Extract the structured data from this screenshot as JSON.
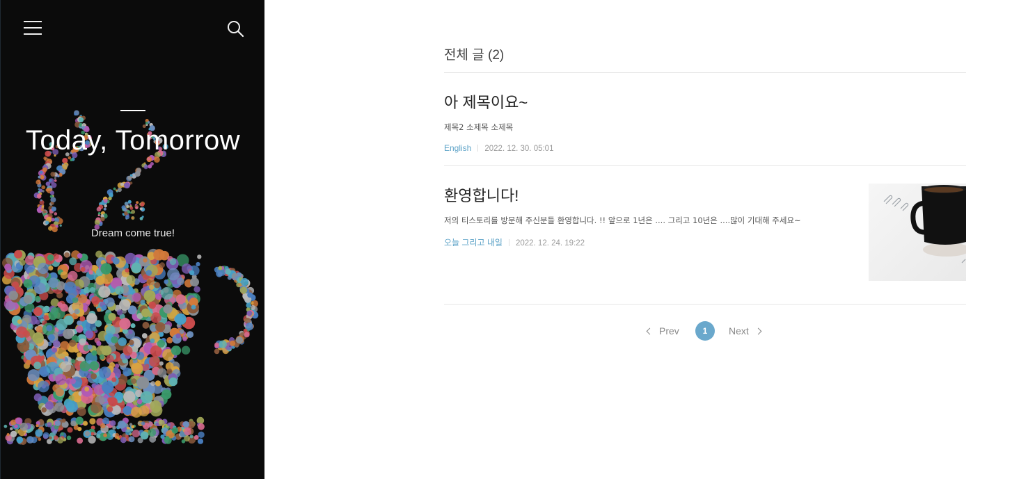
{
  "sidebar": {
    "blog_title": "Today, Tomorrow",
    "subtitle": "Dream come true!",
    "menu_icon": "hamburger-menu-icon",
    "search_icon": "search-icon",
    "background_color": "#0b0b0b"
  },
  "content": {
    "category_heading": "전체 글 (2)",
    "posts": [
      {
        "title": "아 제목이요~",
        "summary": "제목2 소제목 소제목",
        "category": "English",
        "date": "2022. 12. 30. 05:01"
      },
      {
        "title": "환영합니다!",
        "summary": "저의 티스토리를 방문해 주신분들 환영합니다. !! 앞으로 1년은 .... 그리고 10년은 ....많이 기대해 주세요~",
        "category": "오늘 그리고 내일",
        "date": "2022. 12. 24. 19:22",
        "thumbnail_icon": "coffee-mug-thumbnail"
      }
    ]
  },
  "pagination": {
    "prev_label": "Prev",
    "current_page": "1",
    "next_label": "Next",
    "accent_color": "#6aa8cc"
  },
  "colors": {
    "link_accent": "#5fa4c8"
  }
}
